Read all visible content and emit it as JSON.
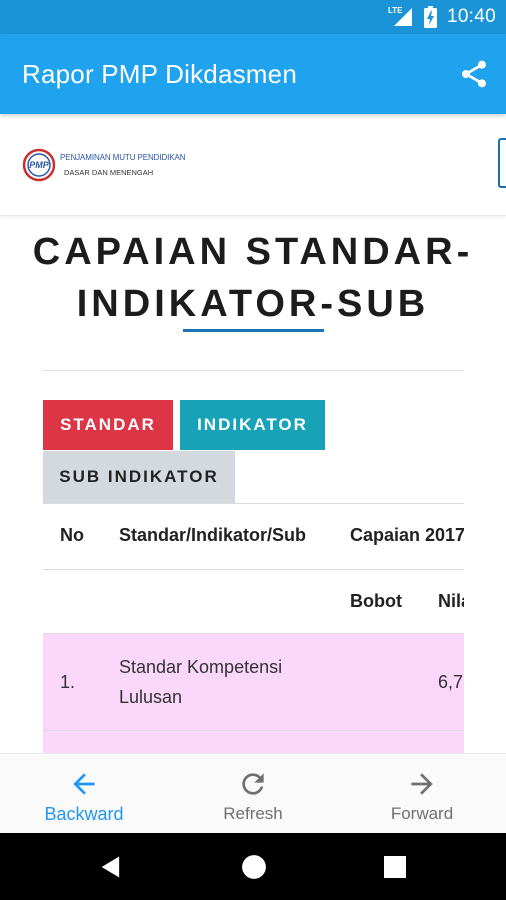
{
  "status_bar": {
    "network": "LTE",
    "time": "10:40"
  },
  "app_bar": {
    "title": "Rapor PMP Dikdasmen",
    "share_icon": "share-icon"
  },
  "header": {
    "logo_mark": "PMP",
    "logo_line1": "PENJAMINAN MUTU PENDIDIKAN",
    "logo_line2": "DASAR DAN MENENGAH"
  },
  "page": {
    "title_line1": "CAPAIAN STANDAR-",
    "title_line2": "INDIKATOR-SUB"
  },
  "tabs": [
    {
      "label": "STANDAR",
      "color": "#dc3545"
    },
    {
      "label": "INDIKATOR",
      "color": "#17a2b8"
    },
    {
      "label": "SUB INDIKATOR",
      "color": "#d4d9df"
    }
  ],
  "table": {
    "headers": {
      "no": "No",
      "name": "Standar/Indikator/Sub",
      "capaian": "Capaian 2017",
      "bobot": "Bobot",
      "nilai": "Nilai"
    },
    "rows": [
      {
        "no": "1.",
        "name_line1": "Standar Kompetensi",
        "name_line2": "Lulusan",
        "bobot": "",
        "nilai": "6,7"
      }
    ],
    "row_color": "#fbd7fb"
  },
  "bottom_nav": {
    "backward": "Backward",
    "refresh": "Refresh",
    "forward": "Forward",
    "active_color": "#2196f3"
  },
  "colors": {
    "status_bar": "#1a93d7",
    "app_bar": "#20a3ee",
    "title_rule": "#1f73b7"
  }
}
